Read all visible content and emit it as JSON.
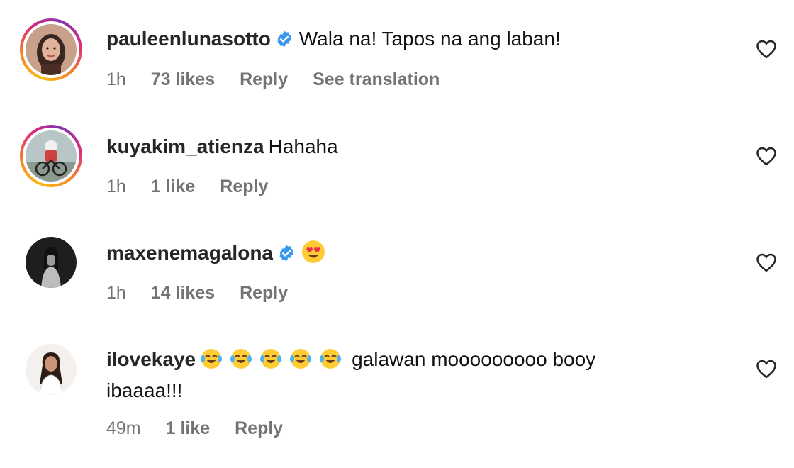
{
  "comments": [
    {
      "username": "pauleenlunasotto",
      "verified": true,
      "text": "Wala na! Tapos na ang laban!",
      "time": "1h",
      "likes": "73 likes",
      "reply": "Reply",
      "translate": "See translation",
      "avatar_story_ring": true
    },
    {
      "username": "kuyakim_atienza",
      "verified": false,
      "text": "Hahaha",
      "time": "1h",
      "likes": "1 like",
      "reply": "Reply",
      "avatar_story_ring": true
    },
    {
      "username": "maxenemagalona",
      "verified": true,
      "text": "",
      "emoji": "heart-eyes",
      "time": "1h",
      "likes": "14 likes",
      "reply": "Reply",
      "avatar_story_ring": false
    },
    {
      "username": "ilovekaye",
      "verified": false,
      "emoji": "laughing-tears",
      "emoji_count": 5,
      "text": "galawan mooooooooo booy",
      "text_line2": "ibaaaa!!!",
      "time": "49m",
      "likes": "1 like",
      "reply": "Reply",
      "avatar_story_ring": false
    }
  ],
  "colors": {
    "verified": "#3897f0",
    "meta": "#737373",
    "username": "#262626"
  },
  "icons": {
    "like": "heart-outline-icon",
    "verified": "verified-badge-icon"
  }
}
